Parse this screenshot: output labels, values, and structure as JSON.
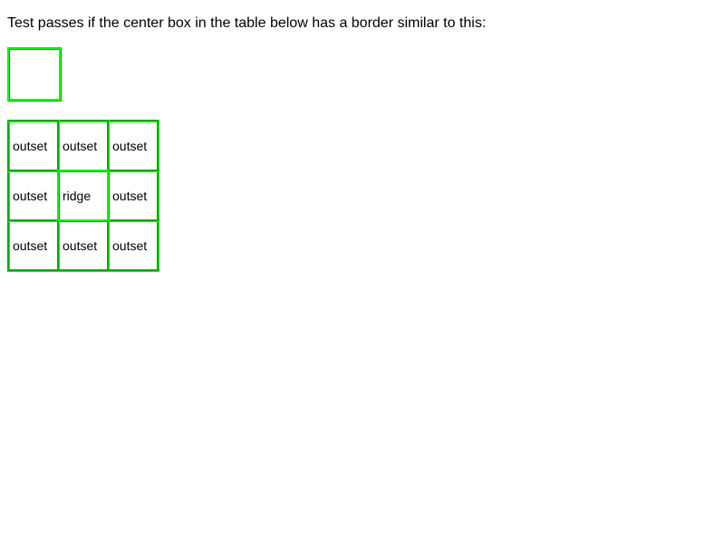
{
  "instruction": "Test passes if the center box in the table below has a border similar to this:",
  "table": {
    "rows": [
      [
        "outset",
        "outset",
        "outset"
      ],
      [
        "outset",
        "ridge",
        "outset"
      ],
      [
        "outset",
        "outset",
        "outset"
      ]
    ]
  },
  "colors": {
    "border": "#00ff00",
    "text": "#000000",
    "background": "#ffffff"
  }
}
